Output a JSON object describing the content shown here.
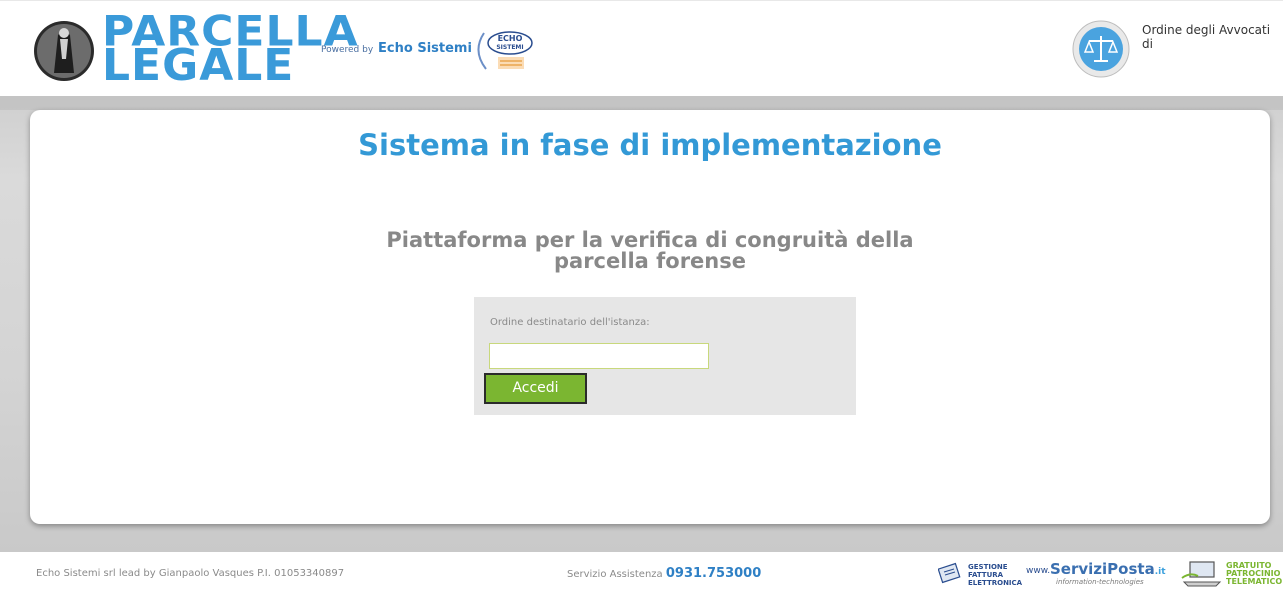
{
  "header": {
    "logo_line1": "PARCELLA",
    "logo_line2": "LEGALE",
    "powered_by": "Powered by",
    "powered_company": "Echo Sistemi",
    "echo_badge": "ECHO SISTEMI",
    "order_text": "Ordine degli Avvocati di"
  },
  "main": {
    "title": "Sistema in fase di implementazione",
    "subtitle_line1": "Piattaforma per la verifica di congruità della",
    "subtitle_line2": "parcella forense",
    "form": {
      "label": "Ordine destinatario dell'istanza:",
      "input_value": "",
      "button_label": "Accedi"
    }
  },
  "footer": {
    "company_text": "Echo Sistemi srl lead by Gianpaolo Vasques P.I. 01053340897",
    "assistance_label": "Servizio Assistenza",
    "assistance_phone": "0931.753000",
    "logos": {
      "fattura_line1": "GESTIONE",
      "fattura_line2": "FATTURA",
      "fattura_line3": "ELETTRONICA",
      "serviziposta_www": "www.",
      "serviziposta_name": "ServiziPosta",
      "serviziposta_suffix": ".it",
      "serviziposta_tag": "information-technologies",
      "gratuito_line1": "GRATUITO",
      "gratuito_line2": "PATROCINIO",
      "gratuito_line3": "TELEMATICO"
    }
  },
  "colors": {
    "brand_blue": "#3399d6",
    "accent_green": "#7bb631",
    "subtitle_gray": "#888888"
  }
}
